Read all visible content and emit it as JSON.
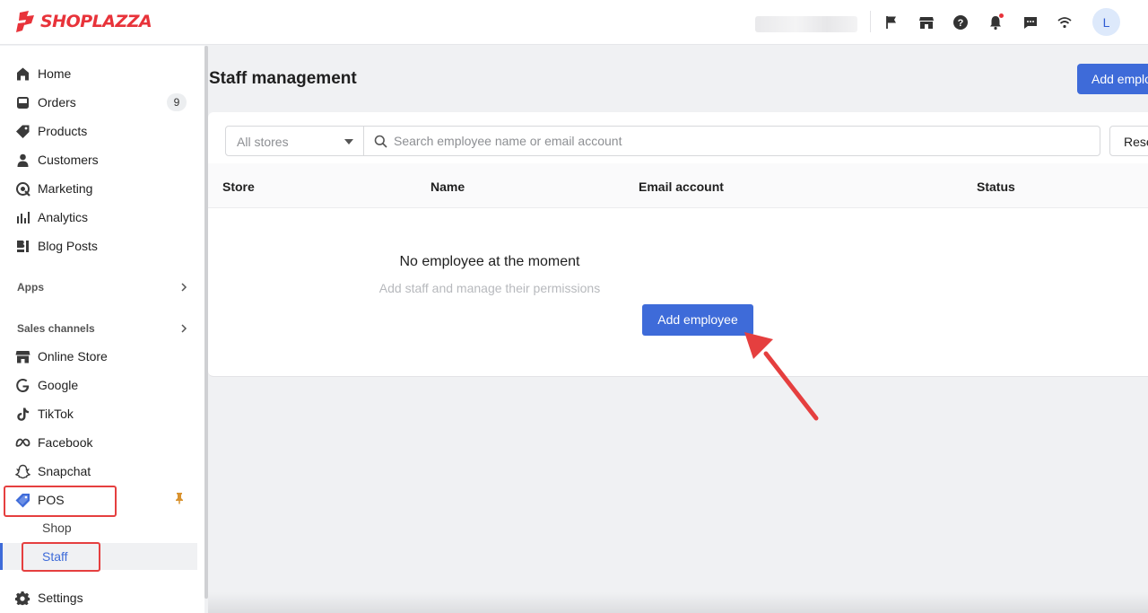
{
  "brand": {
    "name": "SHOPLAZZA",
    "color": "#e8333a"
  },
  "topbar": {
    "icons": [
      "flag-icon",
      "store-icon",
      "help-icon",
      "bell-icon",
      "chat-icon",
      "wifi-icon"
    ],
    "avatar_initial": "L"
  },
  "sidebar": {
    "items": [
      {
        "label": "Home",
        "icon": "home-icon"
      },
      {
        "label": "Orders",
        "icon": "orders-icon",
        "badge": "9"
      },
      {
        "label": "Products",
        "icon": "tag-icon"
      },
      {
        "label": "Customers",
        "icon": "person-icon"
      },
      {
        "label": "Marketing",
        "icon": "marketing-icon"
      },
      {
        "label": "Analytics",
        "icon": "analytics-icon"
      },
      {
        "label": "Blog Posts",
        "icon": "blog-icon"
      }
    ],
    "apps_label": "Apps",
    "sales_channels_label": "Sales channels",
    "channels": [
      {
        "label": "Online Store",
        "icon": "store-icon"
      },
      {
        "label": "Google",
        "icon": "google-icon"
      },
      {
        "label": "TikTok",
        "icon": "tiktok-icon"
      },
      {
        "label": "Facebook",
        "icon": "meta-icon"
      },
      {
        "label": "Snapchat",
        "icon": "snapchat-icon"
      },
      {
        "label": "POS",
        "icon": "pos-tag-icon"
      }
    ],
    "pos_sub": [
      {
        "label": "Shop"
      },
      {
        "label": "Staff",
        "active": true
      }
    ],
    "settings_label": "Settings",
    "accent_color": "#3e6bd9"
  },
  "main": {
    "title": "Staff management",
    "top_button_label": "Add employee",
    "filter": {
      "store_select_value": "All stores",
      "search_placeholder": "Search employee name or email account",
      "reset_label": "Reset"
    },
    "table": {
      "columns": [
        "Store",
        "Name",
        "Email account",
        "Status"
      ]
    },
    "empty_state": {
      "title": "No employee at the moment",
      "subtitle": "Add staff and manage their permissions",
      "button_label": "Add employee"
    }
  },
  "annotations": {
    "highlight_color": "#e53f3f"
  }
}
